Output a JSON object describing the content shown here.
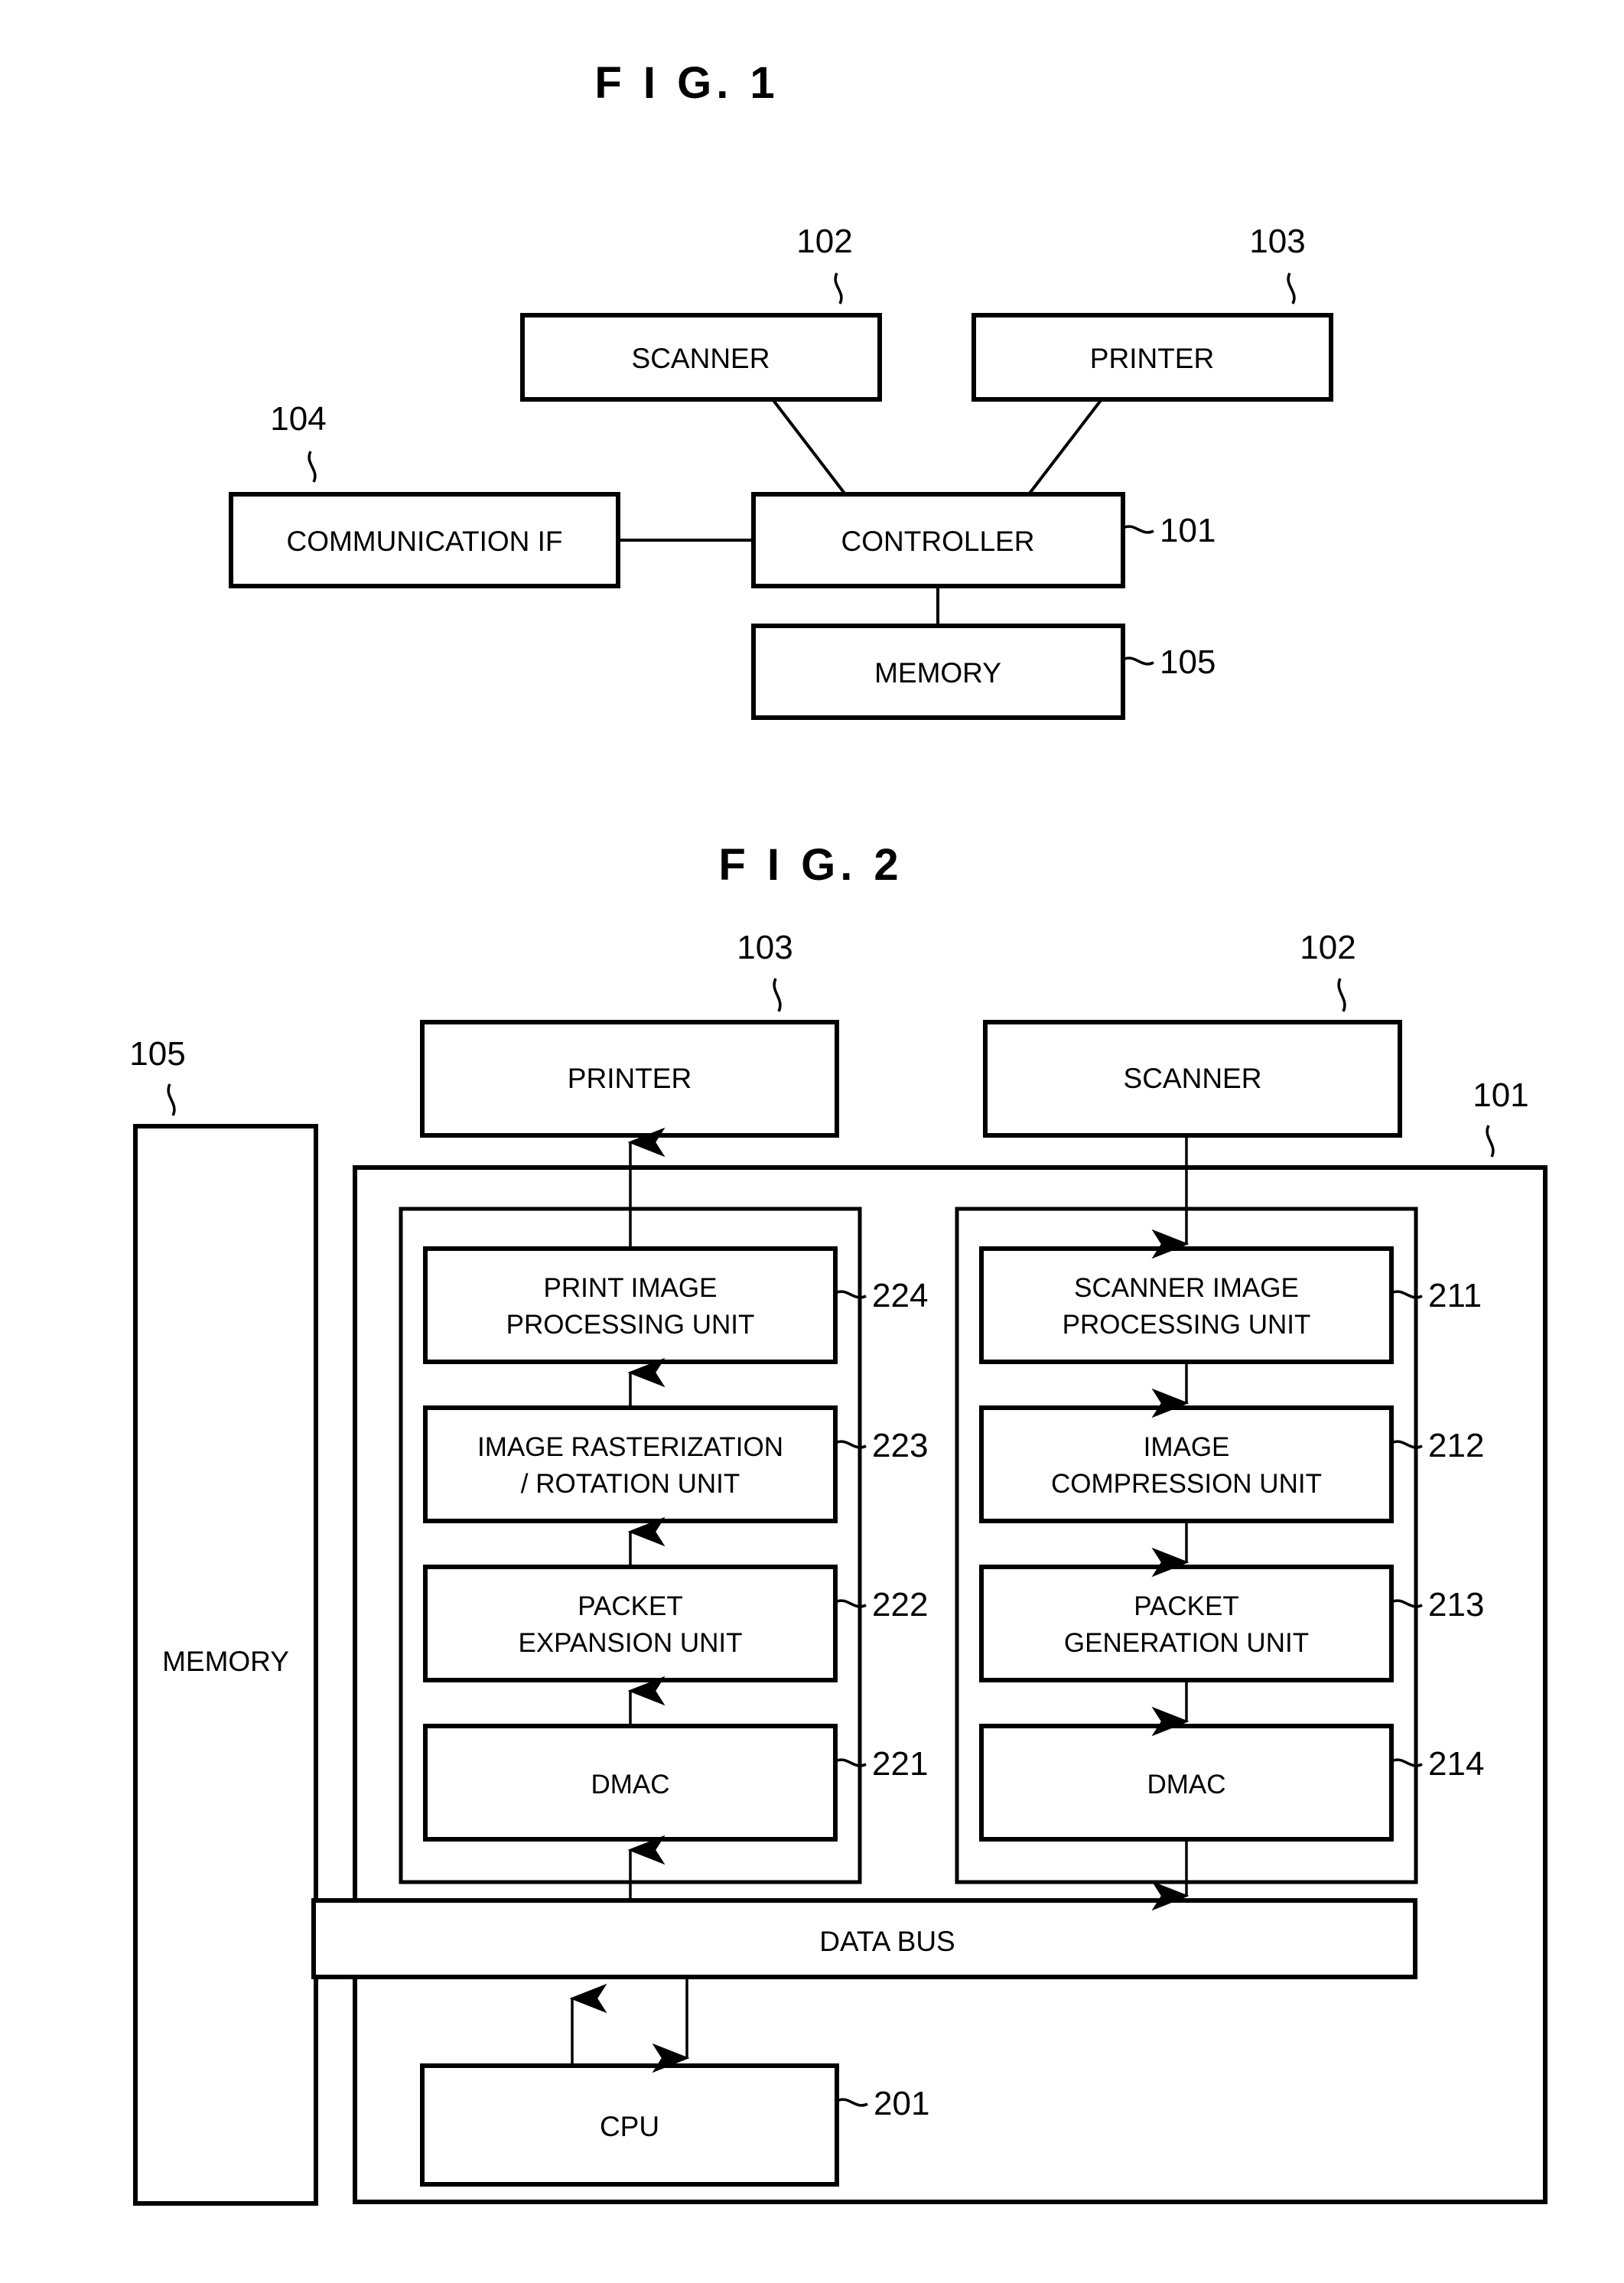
{
  "document": {
    "kind": "patent-figure-sheet",
    "figures": [
      {
        "id": "fig1",
        "title": "F I G.  1",
        "boxes": [
          {
            "key": "scanner",
            "label": "SCANNER",
            "ref": "102"
          },
          {
            "key": "printer",
            "label": "PRINTER",
            "ref": "103"
          },
          {
            "key": "communication",
            "label": "COMMUNICATION IF",
            "ref": "104"
          },
          {
            "key": "controller",
            "label": "CONTROLLER",
            "ref": "101"
          },
          {
            "key": "memory",
            "label": "MEMORY",
            "ref": "105"
          }
        ]
      },
      {
        "id": "fig2",
        "title": "F I G.  2",
        "boxes": [
          {
            "key": "printer",
            "label": "PRINTER",
            "ref": "103"
          },
          {
            "key": "scanner",
            "label": "SCANNER",
            "ref": "102"
          },
          {
            "key": "memory",
            "label": "MEMORY",
            "ref": "105"
          },
          {
            "key": "controller",
            "label": "",
            "ref": "101"
          },
          {
            "key": "print_image_processing",
            "label_line1": "PRINT IMAGE",
            "label_line2": "PROCESSING UNIT",
            "ref": "224"
          },
          {
            "key": "image_rasterization",
            "label_line1": "IMAGE RASTERIZATION",
            "label_line2": "/ ROTATION UNIT",
            "ref": "223"
          },
          {
            "key": "packet_expansion",
            "label_line1": "PACKET",
            "label_line2": "EXPANSION UNIT",
            "ref": "222"
          },
          {
            "key": "dmac_print",
            "label_line1": "DMAC",
            "label_line2": "",
            "ref": "221"
          },
          {
            "key": "scanner_image_processing",
            "label_line1": "SCANNER IMAGE",
            "label_line2": "PROCESSING UNIT",
            "ref": "211"
          },
          {
            "key": "image_compression",
            "label_line1": "IMAGE",
            "label_line2": "COMPRESSION UNIT",
            "ref": "212"
          },
          {
            "key": "packet_generation",
            "label_line1": "PACKET",
            "label_line2": "GENERATION UNIT",
            "ref": "213"
          },
          {
            "key": "dmac_scan",
            "label_line1": "DMAC",
            "label_line2": "",
            "ref": "214"
          },
          {
            "key": "data_bus",
            "label": "DATA BUS",
            "ref": ""
          },
          {
            "key": "cpu",
            "label": "CPU",
            "ref": "201"
          }
        ]
      }
    ]
  },
  "fig1": {
    "title": "F I G.  1",
    "scanner_label": "SCANNER",
    "scanner_ref": "102",
    "printer_label": "PRINTER",
    "printer_ref": "103",
    "communication_label": "COMMUNICATION IF",
    "communication_ref": "104",
    "controller_label": "CONTROLLER",
    "controller_ref": "101",
    "memory_label": "MEMORY",
    "memory_ref": "105"
  },
  "fig2": {
    "title": "F I G.  2",
    "printer_label": "PRINTER",
    "printer_ref": "103",
    "scanner_label": "SCANNER",
    "scanner_ref": "102",
    "memory_label": "MEMORY",
    "memory_ref": "105",
    "controller_ref": "101",
    "print_image_processing_l1": "PRINT IMAGE",
    "print_image_processing_l2": "PROCESSING UNIT",
    "print_image_processing_ref": "224",
    "image_rasterization_l1": "IMAGE RASTERIZATION",
    "image_rasterization_l2": "/ ROTATION UNIT",
    "image_rasterization_ref": "223",
    "packet_expansion_l1": "PACKET",
    "packet_expansion_l2": "EXPANSION UNIT",
    "packet_expansion_ref": "222",
    "dmac_print_label": "DMAC",
    "dmac_print_ref": "221",
    "scanner_image_processing_l1": "SCANNER IMAGE",
    "scanner_image_processing_l2": "PROCESSING UNIT",
    "scanner_image_processing_ref": "211",
    "image_compression_l1": "IMAGE",
    "image_compression_l2": "COMPRESSION UNIT",
    "image_compression_ref": "212",
    "packet_generation_l1": "PACKET",
    "packet_generation_l2": "GENERATION UNIT",
    "packet_generation_ref": "213",
    "dmac_scan_label": "DMAC",
    "dmac_scan_ref": "214",
    "data_bus_label": "DATA BUS",
    "cpu_label": "CPU",
    "cpu_ref": "201"
  },
  "colors": {
    "ink": "#000000",
    "paper": "#ffffff"
  }
}
